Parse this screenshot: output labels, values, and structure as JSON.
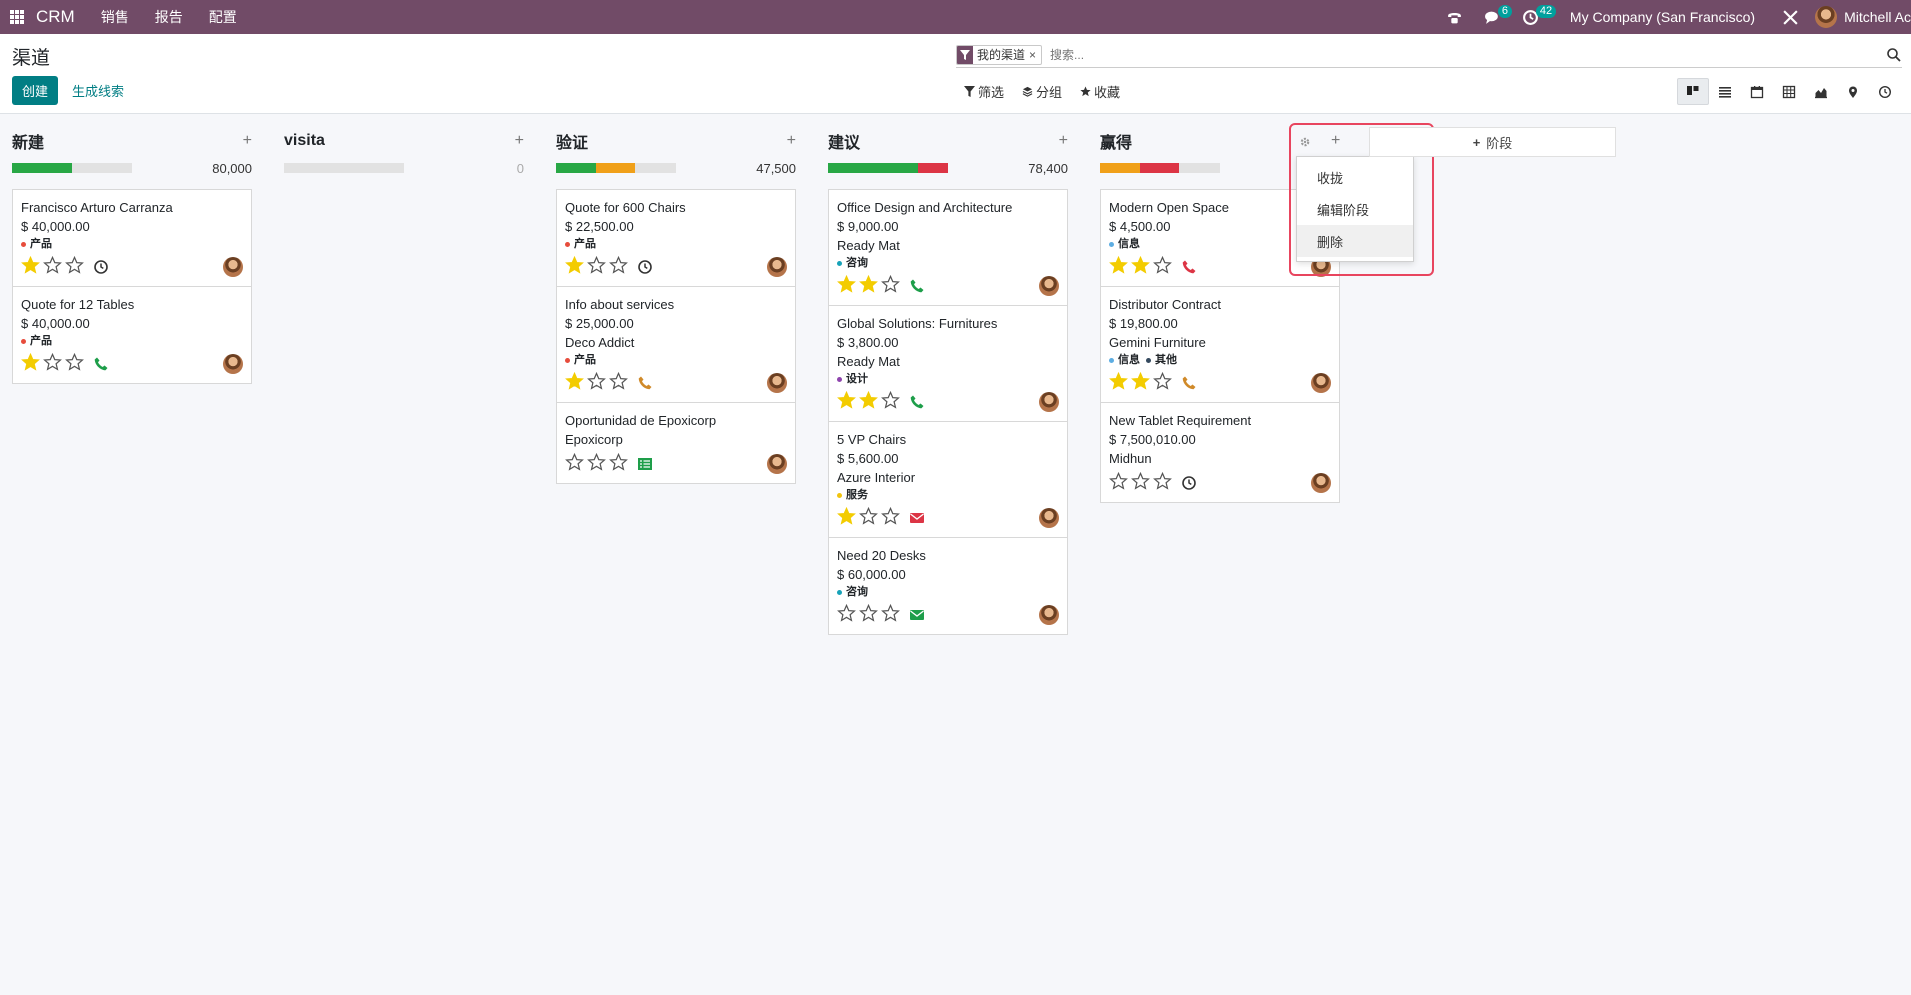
{
  "topbar": {
    "app_name": "CRM",
    "menu": [
      "销售",
      "报告",
      "配置"
    ],
    "messages_count": "6",
    "activities_count": "42",
    "company": "My Company (San Francisco)",
    "user": "Mitchell Ac"
  },
  "control": {
    "page_title": "渠道",
    "create_label": "创建",
    "generate_leads_label": "生成线索",
    "search_facet": "我的渠道",
    "search_placeholder": "搜索...",
    "filter_label": "筛选",
    "groupby_label": "分组",
    "favorites_label": "收藏"
  },
  "colors": {
    "topbar": "#714b67",
    "primary": "#017e84",
    "green": "#28a745",
    "orange": "#f0a019",
    "red": "#dc3545",
    "star": "#f3cc00",
    "highlight": "#e8455e"
  },
  "columns": [
    {
      "title": "新建",
      "total": "80,000",
      "progress": [
        {
          "color": "#28a745",
          "fraction": 0.5
        }
      ],
      "cards": [
        {
          "title": "Francisco Arturo Carranza",
          "lines": [
            "$ 40,000.00"
          ],
          "tags": [
            {
              "label": "产品",
              "color": "#e74c3c"
            }
          ],
          "stars": 1,
          "activity": "clock-icon"
        },
        {
          "title": "Quote for 12 Tables",
          "lines": [
            "$ 40,000.00"
          ],
          "tags": [
            {
              "label": "产品",
              "color": "#e74c3c"
            }
          ],
          "stars": 1,
          "activity": "phone-icon"
        }
      ]
    },
    {
      "title": "visita",
      "total": "0",
      "progress": [],
      "cards": []
    },
    {
      "title": "验证",
      "total": "47,500",
      "progress": [
        {
          "color": "#28a745",
          "fraction": 0.33
        },
        {
          "color": "#f0a019",
          "fraction": 0.33
        }
      ],
      "cards": [
        {
          "title": "Quote for 600 Chairs",
          "lines": [
            "$ 22,500.00"
          ],
          "tags": [
            {
              "label": "产品",
              "color": "#e74c3c"
            }
          ],
          "stars": 1,
          "activity": "clock-icon"
        },
        {
          "title": "Info about services",
          "lines": [
            "$ 25,000.00",
            "Deco Addict"
          ],
          "tags": [
            {
              "label": "产品",
              "color": "#e74c3c"
            }
          ],
          "stars": 1,
          "activity": "phone-icon"
        },
        {
          "title": "Oportunidad de Epoxicorp",
          "lines": [
            "Epoxicorp"
          ],
          "tags": [],
          "stars": 0,
          "activity": "list-icon"
        }
      ]
    },
    {
      "title": "建议",
      "total": "78,400",
      "progress": [
        {
          "color": "#28a745",
          "fraction": 0.75
        },
        {
          "color": "#dc3545",
          "fraction": 0.25
        }
      ],
      "cards": [
        {
          "title": "Office Design and Architecture",
          "lines": [
            "$ 9,000.00",
            "Ready Mat"
          ],
          "tags": [
            {
              "label": "咨询",
              "color": "#17a2b8"
            }
          ],
          "stars": 2,
          "activity": "phone-icon"
        },
        {
          "title": "Global Solutions: Furnitures",
          "lines": [
            "$ 3,800.00",
            "Ready Mat"
          ],
          "tags": [
            {
              "label": "设计",
              "color": "#8e44ad"
            }
          ],
          "stars": 2,
          "activity": "phone-icon"
        },
        {
          "title": "5 VP Chairs",
          "lines": [
            "$ 5,600.00",
            "Azure Interior"
          ],
          "tags": [
            {
              "label": "服务",
              "color": "#f1c40f"
            }
          ],
          "stars": 1,
          "activity": "email-icon"
        },
        {
          "title": "Need 20 Desks",
          "lines": [
            "$ 60,000.00"
          ],
          "tags": [
            {
              "label": "咨询",
              "color": "#17a2b8"
            }
          ],
          "stars": 0,
          "activity": "email-icon"
        }
      ]
    },
    {
      "title": "赢得",
      "total": "",
      "progress": [
        {
          "color": "#f0a019",
          "fraction": 0.33
        },
        {
          "color": "#dc3545",
          "fraction": 0.33
        }
      ],
      "cards": [
        {
          "title": "Modern Open Space",
          "lines": [
            "$ 4,500.00"
          ],
          "tags": [
            {
              "label": "信息",
              "color": "#5dade2"
            }
          ],
          "stars": 2,
          "activity": "phone-icon"
        },
        {
          "title": "Distributor Contract",
          "lines": [
            "$ 19,800.00",
            "Gemini Furniture"
          ],
          "tags": [
            {
              "label": "信息",
              "color": "#5dade2"
            },
            {
              "label": "其他",
              "color": "#34495e"
            }
          ],
          "stars": 2,
          "activity": "phone-icon"
        },
        {
          "title": "New Tablet Requirement",
          "lines": [
            "$ 7,500,010.00",
            "Midhun"
          ],
          "tags": [],
          "stars": 0,
          "activity": "clock-icon"
        }
      ]
    }
  ],
  "column_menu": {
    "items": [
      "收拢",
      "编辑阶段",
      "删除"
    ],
    "hovered": "删除"
  },
  "add_stage_label": "阶段"
}
